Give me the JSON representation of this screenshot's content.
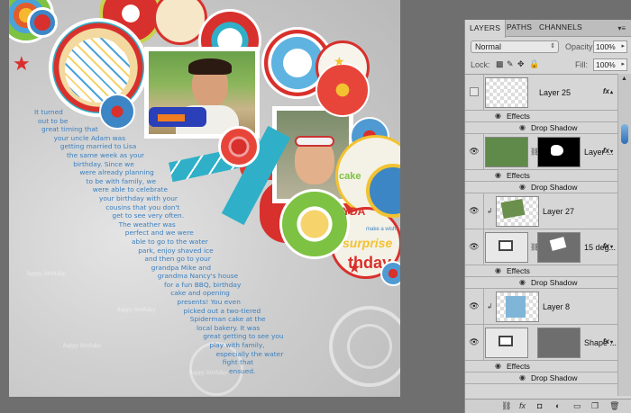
{
  "canvas": {
    "journal_lines": [
      "It turned",
      "out to be",
      "great timing that",
      "your uncle Adam was",
      "getting married to Lisa",
      "the same week as your",
      "birthday.  Since we",
      "were already planning",
      "to be with family, we",
      "were able to celebrate",
      "your birthday with your",
      "cousins that you don't",
      "get to see very often.",
      "The weather was",
      "perfect and we were",
      "able to go to the water",
      "park, enjoy shaved ice",
      "and then go to your",
      "grandpa Mike and",
      "grandma Nancy's house",
      "for a fun BBQ, birthday",
      "cake and opening",
      "presents!  You even",
      "picked out a two-tiered",
      "Spiderman cake at the",
      "local bakery.  It was",
      "great getting to see you",
      "play with family,",
      "especially the water",
      "fight that",
      "ensued."
    ],
    "background_text": "happy birthday",
    "word_art": [
      "cake",
      "DAY",
      "surprise",
      "thday",
      "make a wish!",
      "YDA"
    ],
    "colors": {
      "accent_blue": "#3a7fbf",
      "red": "#d8302c",
      "yellow": "#f2c230",
      "teal": "#2fb0c8"
    }
  },
  "panel": {
    "tabs": [
      "LAYERS",
      "PATHS",
      "CHANNELS"
    ],
    "menu_icon": "panel-menu-icon",
    "blend_mode": "Normal",
    "opacity_label": "Opacity:",
    "opacity_value": "100%",
    "lock_label": "Lock:",
    "fill_label": "Fill:",
    "fill_value": "100%",
    "layers": [
      {
        "name": "Layer 25",
        "visible": false,
        "fx": "fx"
      },
      {
        "name": "Effects"
      },
      {
        "name": "Drop Shadow"
      },
      {
        "name": "Layer ...",
        "visible": true,
        "fx": "fx"
      },
      {
        "name": "Effects"
      },
      {
        "name": "Drop Shadow"
      },
      {
        "name": "Layer 27",
        "visible": true
      },
      {
        "name": "15 deg...",
        "visible": true,
        "fx": "fx"
      },
      {
        "name": "Effects"
      },
      {
        "name": "Drop Shadow"
      },
      {
        "name": "Layer 8",
        "visible": true
      },
      {
        "name": "Shape ...",
        "visible": true,
        "fx": "fx"
      },
      {
        "name": "Effects"
      },
      {
        "name": "Drop Shadow"
      }
    ],
    "bottom_icons": [
      "link-icon",
      "fx-icon",
      "mask-icon",
      "adjustment-icon",
      "group-icon",
      "new-layer-icon",
      "trash-icon"
    ]
  }
}
